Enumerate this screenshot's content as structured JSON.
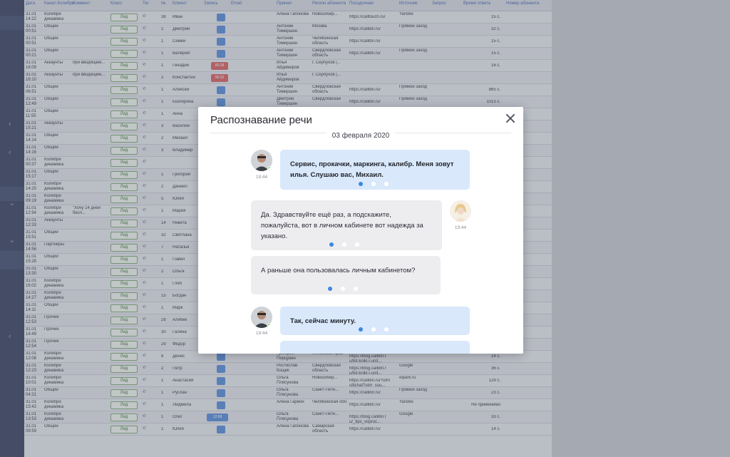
{
  "table": {
    "headers": [
      "Дата",
      "Канал Колибри",
      "Коммент",
      "Класс",
      "Тег",
      "№",
      "Клиент",
      "Запись",
      "Email",
      "Принял",
      "Регион абонента",
      "Посадочная",
      "Источник",
      "Запрос",
      "Время ответа",
      "Номер абонента"
    ],
    "rows": [
      {
        "date": "31.01 14:22",
        "channel": "Колибри динамика",
        "comment": "",
        "cls": "Лид",
        "num": "38",
        "client": "Иван",
        "who": "Алена Гапонова",
        "region": "Новосибир...",
        "landing": "https://calltouch.ru/",
        "src": "Yandex",
        "time": "15 с.",
        "rec": "plain"
      },
      {
        "date": "31.01 00:51",
        "channel": "Общий",
        "comment": "",
        "cls": "Лид",
        "num": "1",
        "client": "Дмитрий",
        "who": "Антоний Тимиршин",
        "region": "Москва",
        "landing": "https://callibri.ru/",
        "src": "Прямой заход",
        "time": "32 с.",
        "rec": "plain"
      },
      {
        "date": "31.01 00:51",
        "channel": "Общий",
        "comment": "",
        "cls": "Лид",
        "num": "1",
        "client": "Семен",
        "who": "Антоний Тимиршин",
        "region": "Челябинская область",
        "landing": "https://callibri.ru/",
        "src": "",
        "time": "15 с.",
        "rec": "plain"
      },
      {
        "date": "31.01 00:21",
        "channel": "Общий",
        "comment": "",
        "cls": "Лид",
        "num": "1",
        "client": "Валерия",
        "who": "Антоний Тимиршин",
        "region": "Свердловская область",
        "landing": "https://callibri.ru/",
        "src": "Прямой заход",
        "time": "15 с.",
        "rec": "plain"
      },
      {
        "date": "31.01 16:09",
        "channel": "Аккаунты",
        "comment": "при вводящем...",
        "cls": "Лид",
        "num": "1",
        "client": "Генадий",
        "who": "Илья Айдимиров",
        "region": "г. Серпухов |...",
        "landing": "",
        "src": "",
        "time": "16 с.",
        "rec": "red",
        "rec_time": "00:28"
      },
      {
        "date": "31.01 16:10",
        "channel": "Аккаунты",
        "comment": "при вводящем...",
        "cls": "Лид",
        "num": "2",
        "client": "Константин",
        "who": "Илья Айдимиров",
        "region": "г. Серпухов |...",
        "landing": "",
        "src": "",
        "time": "",
        "rec": "red",
        "rec_time": "00:32"
      },
      {
        "date": "31.01 06:51",
        "channel": "Общий",
        "comment": "",
        "cls": "Лид",
        "num": "1",
        "client": "Алексей",
        "who": "Антоний Тимиршин",
        "region": "Свердловская область",
        "landing": "https://callibri.ru/",
        "src": "Прямой заход",
        "time": "865 с.",
        "rec": "plain"
      },
      {
        "date": "31.01 12:49",
        "channel": "Общий",
        "comment": "",
        "cls": "Лид",
        "num": "1",
        "client": "Екатерина",
        "who": "Дмитрий Тимиршин",
        "region": "Свердловская",
        "landing": "https://callibri.ru/",
        "src": "Прямой заход",
        "time": "1013 с.",
        "rec": "plain"
      },
      {
        "date": "31.01 11:55",
        "channel": "Общий",
        "comment": "",
        "cls": "Лид",
        "num": "1",
        "client": "Анна",
        "who": "",
        "region": "",
        "landing": "",
        "src": "",
        "time": "",
        "rec": "plain"
      },
      {
        "date": "31.01 15:21",
        "channel": "Аккаунты",
        "comment": "",
        "cls": "Лид",
        "num": "3",
        "client": "Василий",
        "who": "",
        "region": "",
        "landing": "",
        "src": "",
        "time": "",
        "rec": "plain"
      },
      {
        "date": "31.01 14:14",
        "channel": "Общий",
        "comment": "",
        "cls": "Лид",
        "num": "2",
        "client": "Михаил",
        "who": "",
        "region": "",
        "landing": "",
        "src": "",
        "time": "",
        "rec": "plain"
      },
      {
        "date": "31.01 14:16",
        "channel": "Общий",
        "comment": "",
        "cls": "Лид",
        "num": "3",
        "client": "Владимир",
        "who": "",
        "region": "",
        "landing": "",
        "src": "",
        "time": "",
        "rec": "plain"
      },
      {
        "date": "31.01 00:37",
        "channel": "Колибри динамика",
        "comment": "",
        "cls": "Лид",
        "num": "",
        "client": "",
        "who": "",
        "region": "",
        "landing": "",
        "src": "",
        "time": "",
        "rec": "none"
      },
      {
        "date": "31.01 15:17",
        "channel": "Общий",
        "comment": "",
        "cls": "Лид",
        "num": "1",
        "client": "Григорий",
        "who": "",
        "region": "",
        "landing": "",
        "src": "",
        "time": "",
        "rec": "none"
      },
      {
        "date": "31.01 14:20",
        "channel": "Колибри динамика",
        "comment": "",
        "cls": "Лид",
        "num": "2",
        "client": "Даниил",
        "who": "",
        "region": "",
        "landing": "",
        "src": "",
        "time": "",
        "rec": "none"
      },
      {
        "date": "31.01 09:19",
        "channel": "Колибри динамика",
        "comment": "",
        "cls": "Лид",
        "num": "5",
        "client": "Юлия",
        "who": "",
        "region": "",
        "landing": "",
        "src": "",
        "time": "",
        "rec": "none"
      },
      {
        "date": "31.01 12:54",
        "channel": "Колибри динамика",
        "comment": "\"Хочу 14 дней бесп...",
        "cls": "Лид",
        "num": "1",
        "client": "Мария",
        "who": "",
        "region": "",
        "landing": "",
        "src": "",
        "time": "",
        "rec": "none"
      },
      {
        "date": "31.01 12:33",
        "channel": "Аккаунты",
        "comment": "",
        "cls": "Лид",
        "num": "14",
        "client": "Никита",
        "who": "",
        "region": "",
        "landing": "",
        "src": "",
        "time": "",
        "rec": "none"
      },
      {
        "date": "31.01 15:51",
        "channel": "Общий",
        "comment": "",
        "cls": "Лид",
        "num": "32",
        "client": "Светлана",
        "who": "",
        "region": "",
        "landing": "",
        "src": "",
        "time": "",
        "rec": "none"
      },
      {
        "date": "31.01 14:56",
        "channel": "Партнеры",
        "comment": "",
        "cls": "Лид",
        "num": "7",
        "client": "Наталья",
        "who": "",
        "region": "",
        "landing": "",
        "src": "",
        "time": "",
        "rec": "none"
      },
      {
        "date": "31.01 15:28",
        "channel": "Общий",
        "comment": "",
        "cls": "Лид",
        "num": "1",
        "client": "Павел",
        "who": "",
        "region": "",
        "landing": "",
        "src": "",
        "time": "",
        "rec": "none"
      },
      {
        "date": "31.01 13:30",
        "channel": "Общий",
        "comment": "",
        "cls": "Лид",
        "num": "2",
        "client": "Ольга",
        "who": "",
        "region": "",
        "landing": "",
        "src": "",
        "time": "",
        "rec": "none"
      },
      {
        "date": "31.01 16:02",
        "channel": "Колибри динамика",
        "comment": "",
        "cls": "Лид",
        "num": "1",
        "client": "Глеб",
        "who": "",
        "region": "",
        "landing": "",
        "src": "",
        "time": "",
        "rec": "none"
      },
      {
        "date": "31.01 14:27",
        "channel": "Колибри динамика",
        "comment": "",
        "cls": "Лид",
        "num": "15",
        "client": "Богдан",
        "who": "",
        "region": "",
        "landing": "",
        "src": "",
        "time": "",
        "rec": "none"
      },
      {
        "date": "31.01 14:11",
        "channel": "Общий",
        "comment": "",
        "cls": "Лид",
        "num": "1",
        "client": "Марк",
        "who": "",
        "region": "",
        "landing": "",
        "src": "",
        "time": "",
        "rec": "none"
      },
      {
        "date": "31.01 12:53",
        "channel": "Прочие",
        "comment": "",
        "cls": "Лид",
        "num": "28",
        "client": "Алибек",
        "who": "",
        "region": "",
        "landing": "",
        "src": "",
        "time": "",
        "rec": "none"
      },
      {
        "date": "31.01 14:49",
        "channel": "Прочие",
        "comment": "",
        "cls": "Лид",
        "num": "30",
        "client": "Галина",
        "who": "",
        "region": "",
        "landing": "",
        "src": "",
        "time": "",
        "rec": "none"
      },
      {
        "date": "31.01 12:54",
        "channel": "Прочие",
        "comment": "",
        "cls": "Лид",
        "num": "29",
        "client": "Фёдор",
        "who": "",
        "region": "",
        "landing": "",
        "src": "",
        "time": "",
        "rec": "none"
      },
      {
        "date": "31.01 12:08",
        "channel": "Колибри динамика",
        "comment": "",
        "cls": "Лид",
        "num": "8",
        "client": "Денис",
        "who": "Григорий Перцукин",
        "region": "Алтайский край",
        "landing": "https://blog.callibri.r u/bit-kniki-i-unit...",
        "src": "",
        "time": "14 с.",
        "rec": "plain"
      },
      {
        "date": "31.01 12:23",
        "channel": "Колибри динамика",
        "comment": "",
        "cls": "Лид",
        "num": "2",
        "client": "Петр",
        "who": "Ростислав Кощик",
        "region": "Свердловская область",
        "landing": "https://blog.callibri.r u/bit-kniki-i-unit...",
        "src": "Google",
        "time": "36 с.",
        "rec": "plain"
      },
      {
        "date": "31.01 10:01",
        "channel": "Колибри динамика",
        "comment": "",
        "cls": "Лид",
        "num": "1",
        "client": "Анастасия",
        "who": "Ольга Плясунова",
        "region": "Новосибир...",
        "landing": "https://callibri.ru/?utm ultichat?utm_sou...",
        "src": "elpark.ru",
        "time": "129 с.",
        "rec": "plain"
      },
      {
        "date": "31.01 04:21",
        "channel": "Общий",
        "comment": "",
        "cls": "Лид",
        "num": "1",
        "client": "Руслан",
        "who": "Ольга Плясунова",
        "region": "Санкт-Петe...",
        "landing": "https://callibri.ru/",
        "src": "Прямой заход",
        "time": "23 с.",
        "rec": "plain"
      },
      {
        "date": "31.01 15:42",
        "channel": "Колибри динамика",
        "comment": "",
        "cls": "Лид",
        "num": "1",
        "client": "Людмила",
        "who": "Алена Гарион",
        "region": "Челябинская обл.",
        "landing": "https://callibri.ru/",
        "src": "Yandex",
        "time": "Не применимо",
        "rec": "plain"
      },
      {
        "date": "31.01 13:53",
        "channel": "Колибри динамика",
        "comment": "",
        "cls": "Лид",
        "num": "1",
        "client": "Олег",
        "who": "Ольга Плясунова",
        "region": "Санкт-Петe...",
        "landing": "https://blog.callibri.r u/_tips_voproc...",
        "src": "Google",
        "time": "33 с.",
        "rec": "play",
        "rec_time": "12:58"
      },
      {
        "date": "31.01 09:59",
        "channel": "Общий",
        "comment": "",
        "cls": "Лид",
        "num": "1",
        "client": "Юлия",
        "who": "Алена Гапонова",
        "region": "Самарская область",
        "landing": "https://callibri.ru/",
        "src": "",
        "time": "14 с.",
        "rec": "plain"
      }
    ]
  },
  "modal": {
    "title": "Распознавание речи",
    "date": "03 февраля 2020",
    "messages": [
      {
        "speaker": "operator",
        "time": "19:44",
        "text": "Сервис, прокачки, маркинга, калибр. Меня зовут илья. Слушаю вас, Михаил.",
        "dot_active": 0
      },
      {
        "speaker": "client",
        "time": "19:44",
        "text": "Да. Здравствуйте ещё раз, а подскажите, пожалуйста, вот в личном кабинете вот надежда за указано.",
        "dot_active": 0
      },
      {
        "speaker": "client",
        "time": "",
        "text": "А раньше она пользовалась личным кабинетом?",
        "dot_active": 0
      },
      {
        "speaker": "operator",
        "time": "19:44",
        "text": "Так, сейчас минуту.",
        "dot_active": 0
      }
    ]
  },
  "colors": {
    "operator_bubble": "#d9e8fb",
    "client_bubble": "#ededf0",
    "dot_active": "#3c86e0",
    "status_online": "#6cc04a"
  }
}
